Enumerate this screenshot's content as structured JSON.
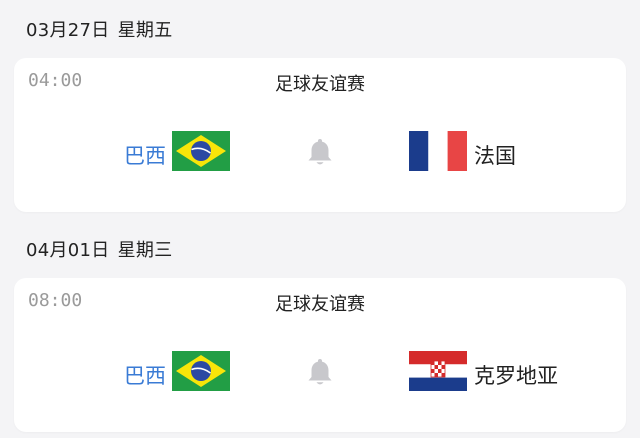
{
  "matches": [
    {
      "date": "03月27日",
      "weekday": "星期五",
      "time": "04:00",
      "competition": "足球友谊赛",
      "home_team": "巴西",
      "home_flag": "brazil-flag-icon",
      "away_team": "法国",
      "away_flag": "france-flag-icon"
    },
    {
      "date": "04月01日",
      "weekday": "星期三",
      "time": "08:00",
      "competition": "足球友谊赛",
      "home_team": "巴西",
      "home_flag": "brazil-flag-icon",
      "away_team": "克罗地亚",
      "away_flag": "croatia-flag-icon"
    }
  ],
  "colors": {
    "home_team_text": "#3a7bd5",
    "time_text": "#9a9a9a",
    "bell_icon": "#c8c8cc",
    "background": "#f4f4f6"
  }
}
